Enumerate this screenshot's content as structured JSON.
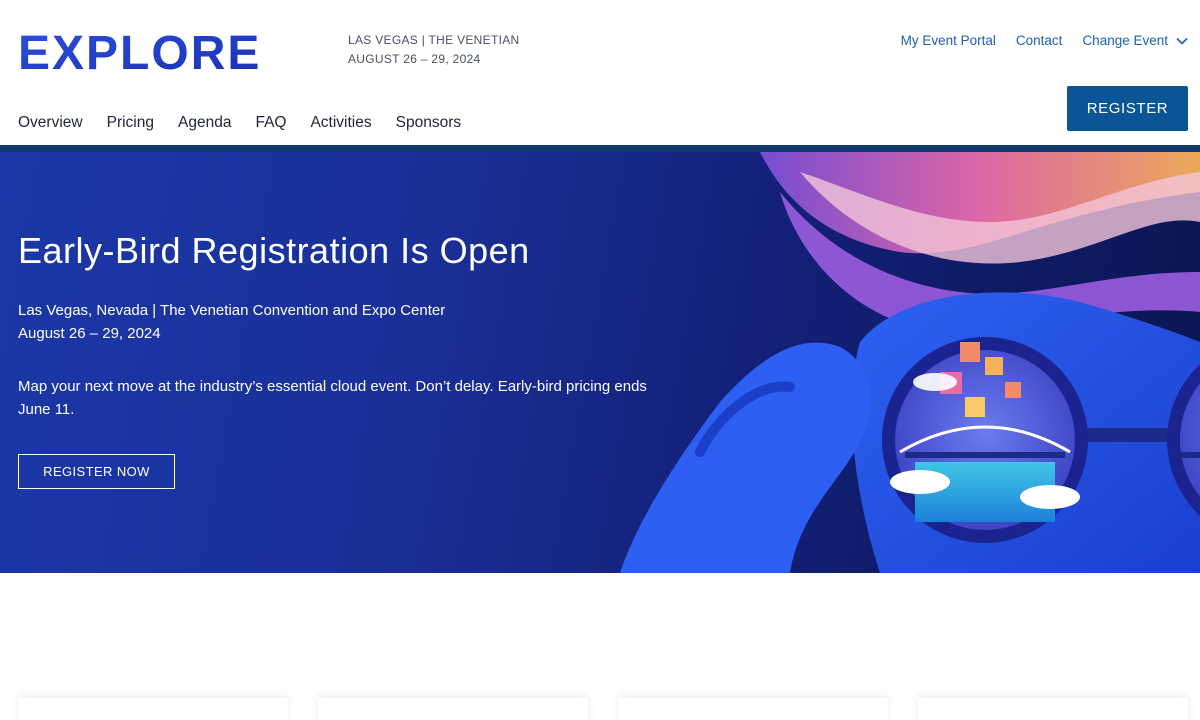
{
  "brand": {
    "logo_text": "EXPLORE",
    "accent": "#1d5fb6",
    "logo_color": "#2340c9"
  },
  "event": {
    "location": "LAS VEGAS | THE VENETIAN",
    "dates": "AUGUST 26 – 29, 2024"
  },
  "top_links": {
    "portal": "My Event Portal",
    "contact": "Contact",
    "change_event": "Change Event"
  },
  "nav": {
    "items": [
      "Overview",
      "Pricing",
      "Agenda",
      "FAQ",
      "Activities",
      "Sponsors"
    ]
  },
  "register_label": "REGISTER",
  "hero": {
    "title": "Early-Bird Registration Is Open",
    "location_line": "Las Vegas, Nevada | The Venetian Convention and Expo Center",
    "date_line": "August 26 – 29, 2024",
    "description": "Map your next move at the industry’s essential cloud event. Don’t delay. Early-bird pricing ends June 11.",
    "cta": "REGISTER NOW"
  },
  "icons": {
    "change_event_chevron": "chevron-down-icon"
  }
}
